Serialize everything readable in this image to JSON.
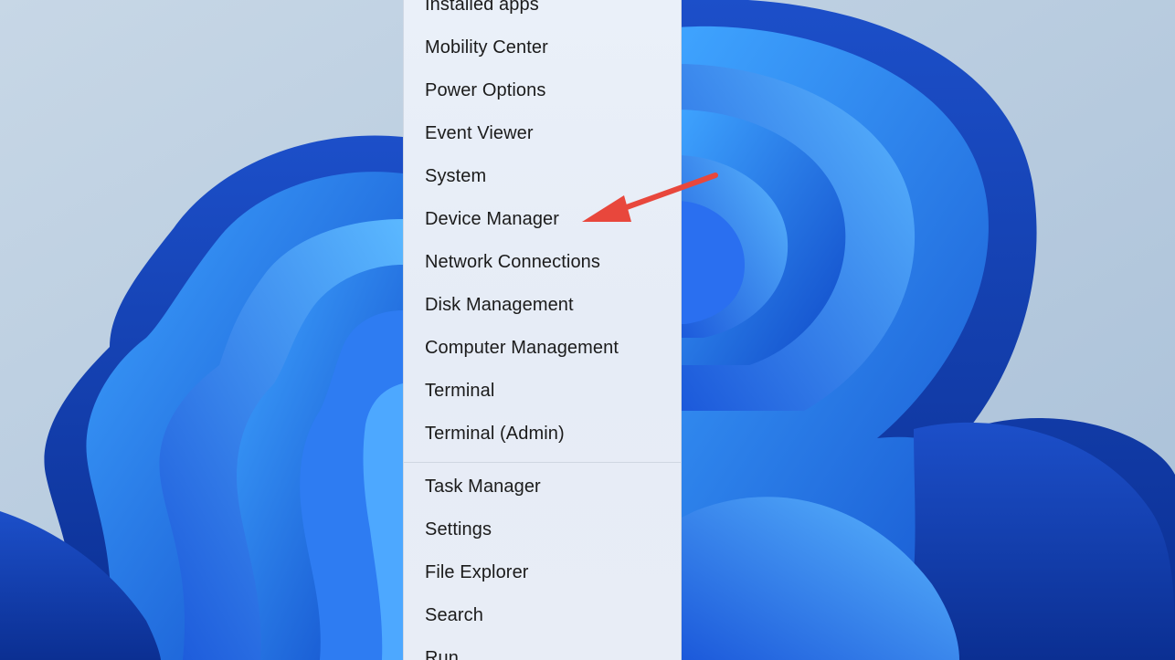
{
  "menu": {
    "items_top": [
      {
        "label": "Installed apps"
      },
      {
        "label": "Mobility Center"
      },
      {
        "label": "Power Options"
      },
      {
        "label": "Event Viewer"
      },
      {
        "label": "System"
      },
      {
        "label": "Device Manager"
      },
      {
        "label": "Network Connections"
      },
      {
        "label": "Disk Management"
      },
      {
        "label": "Computer Management"
      },
      {
        "label": "Terminal"
      },
      {
        "label": "Terminal (Admin)"
      }
    ],
    "items_bottom": [
      {
        "label": "Task Manager"
      },
      {
        "label": "Settings"
      },
      {
        "label": "File Explorer"
      },
      {
        "label": "Search"
      },
      {
        "label": "Run"
      }
    ]
  },
  "annotation": {
    "arrow_color": "#e8473c",
    "points_to": "Device Manager"
  },
  "colors": {
    "wallpaper_bloom": "#1a5fe0",
    "wallpaper_background": "#b9cde0",
    "menu_background": "#e8eef7",
    "menu_text": "#1b1b1b"
  }
}
